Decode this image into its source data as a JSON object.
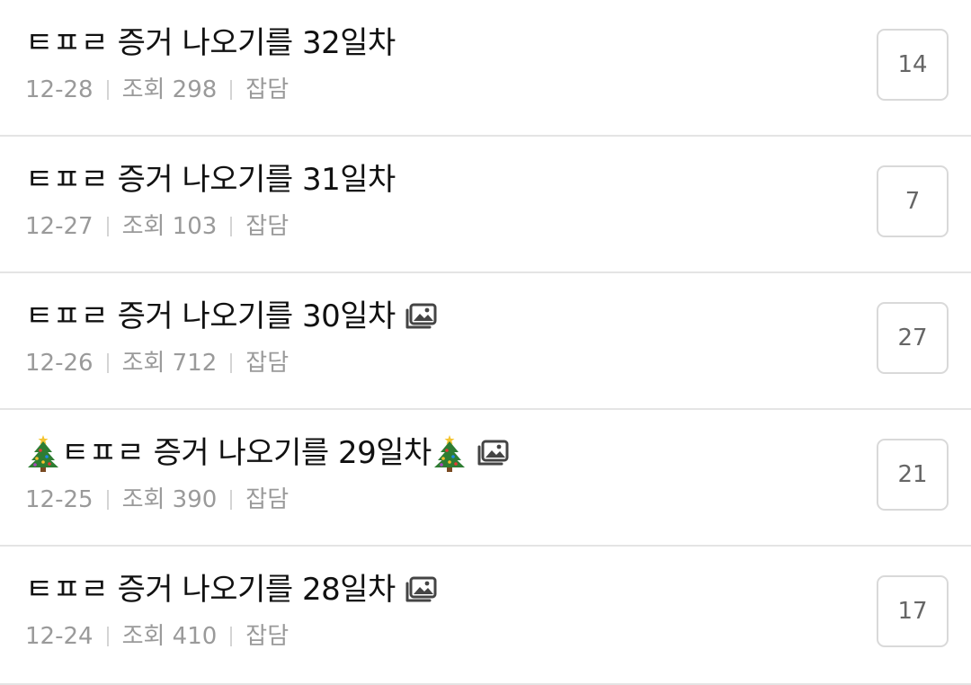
{
  "posts": [
    {
      "title": "ㅌㅍㄹ 증거 나오기를 32일차",
      "date": "12-28",
      "views_label": "조회 298",
      "category": "잡담",
      "comments": "14",
      "has_image": false,
      "tree_before": false,
      "tree_after": false
    },
    {
      "title": "ㅌㅍㄹ 증거 나오기를 31일차",
      "date": "12-27",
      "views_label": "조회 103",
      "category": "잡담",
      "comments": "7",
      "has_image": false,
      "tree_before": false,
      "tree_after": false
    },
    {
      "title": "ㅌㅍㄹ 증거 나오기를 30일차",
      "date": "12-26",
      "views_label": "조회 712",
      "category": "잡담",
      "comments": "27",
      "has_image": true,
      "tree_before": false,
      "tree_after": false
    },
    {
      "title": "ㅌㅍㄹ 증거 나오기를 29일차",
      "date": "12-25",
      "views_label": "조회 390",
      "category": "잡담",
      "comments": "21",
      "has_image": true,
      "tree_before": true,
      "tree_after": true
    },
    {
      "title": "ㅌㅍㄹ 증거 나오기를 28일차",
      "date": "12-24",
      "views_label": "조회 410",
      "category": "잡담",
      "comments": "17",
      "has_image": true,
      "tree_before": false,
      "tree_after": false
    }
  ],
  "icons": {
    "image": "image-icon",
    "tree": "christmas-tree-emoji"
  },
  "colors": {
    "title": "#111111",
    "meta": "#9a9a9a",
    "separator": "#d4d4d4",
    "border": "#e4e4e4",
    "comment_text": "#666666"
  }
}
